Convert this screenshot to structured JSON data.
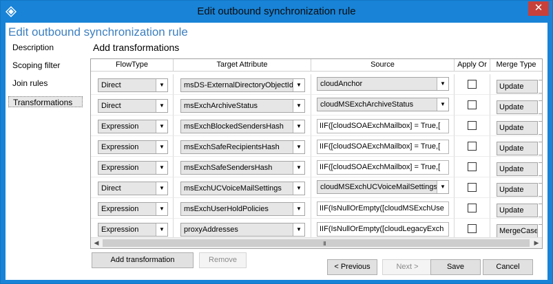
{
  "window": {
    "title": "Edit outbound synchronization rule",
    "close": "✕"
  },
  "page": {
    "title": "Edit outbound synchronization rule"
  },
  "nav": {
    "items": [
      "Description",
      "Scoping filter",
      "Join rules",
      "Transformations"
    ],
    "selected": 3
  },
  "section": {
    "title": "Add transformations"
  },
  "grid": {
    "columns": [
      "FlowType",
      "Target Attribute",
      "Source",
      "Apply Or",
      "Merge Type"
    ],
    "rows": [
      {
        "flowtype": "Direct",
        "target": "msDS-ExternalDirectoryObjectId",
        "source": "cloudAnchor",
        "source_kind": "combo",
        "apply": false,
        "merge": "Update"
      },
      {
        "flowtype": "Direct",
        "target": "msExchArchiveStatus",
        "source": "cloudMSExchArchiveStatus",
        "source_kind": "combo",
        "apply": false,
        "merge": "Update"
      },
      {
        "flowtype": "Expression",
        "target": "msExchBlockedSendersHash",
        "source": "IIF([cloudSOAExchMailbox] = True,[",
        "source_kind": "text",
        "apply": false,
        "merge": "Update"
      },
      {
        "flowtype": "Expression",
        "target": "msExchSafeRecipientsHash",
        "source": "IIF([cloudSOAExchMailbox] = True,[",
        "source_kind": "text",
        "apply": false,
        "merge": "Update"
      },
      {
        "flowtype": "Expression",
        "target": "msExchSafeSendersHash",
        "source": "IIF([cloudSOAExchMailbox] = True,[",
        "source_kind": "text",
        "apply": false,
        "merge": "Update"
      },
      {
        "flowtype": "Direct",
        "target": "msExchUCVoiceMailSettings",
        "source": "cloudMSExchUCVoiceMailSettings",
        "source_kind": "combo",
        "apply": false,
        "merge": "Update"
      },
      {
        "flowtype": "Expression",
        "target": "msExchUserHoldPolicies",
        "source": "IIF(IsNullOrEmpty([cloudMSExchUse",
        "source_kind": "text",
        "apply": false,
        "merge": "Update"
      },
      {
        "flowtype": "Expression",
        "target": "proxyAddresses",
        "source": "IIF(IsNullOrEmpty([cloudLegacyExch",
        "source_kind": "text",
        "apply": false,
        "merge": "MergeCase"
      }
    ],
    "scroll_grip": "III"
  },
  "buttons": {
    "add": "Add transformation",
    "remove": "Remove",
    "previous": "< Previous",
    "next": "Next >",
    "save": "Save",
    "cancel": "Cancel"
  },
  "colors": {
    "titlebar": "#1883d7",
    "page_title": "#3c7fbf",
    "close": "#c7403a"
  }
}
